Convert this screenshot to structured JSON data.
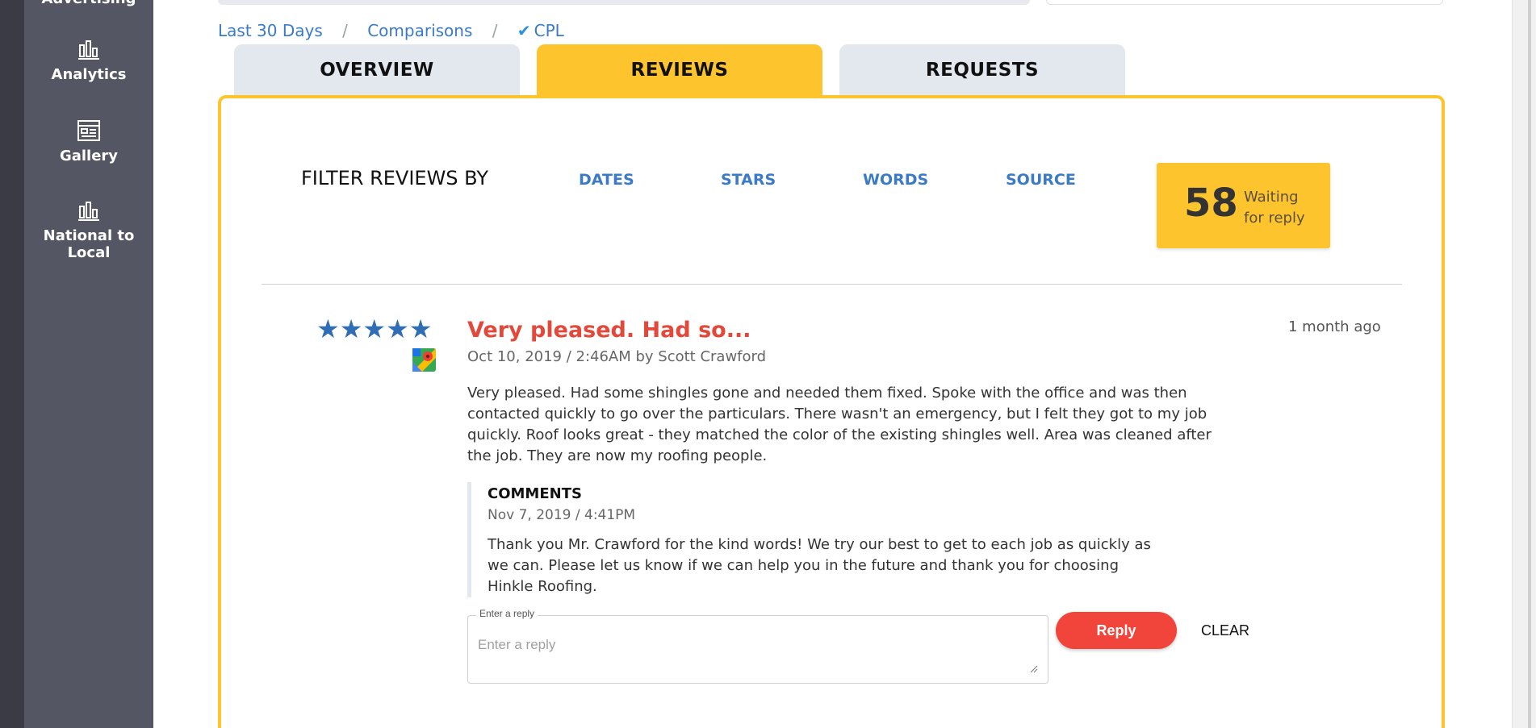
{
  "sidebar": {
    "items": [
      {
        "label": "Advertising"
      },
      {
        "label": "Analytics"
      },
      {
        "label": "Gallery"
      },
      {
        "label": "National to Local"
      }
    ]
  },
  "breadcrumb": {
    "items": [
      "Last 30 Days",
      "Comparisons",
      "CPL"
    ],
    "separator": "/"
  },
  "tabs": [
    {
      "label": "OVERVIEW",
      "active": false
    },
    {
      "label": "REVIEWS",
      "active": true
    },
    {
      "label": "REQUESTS",
      "active": false
    }
  ],
  "filter": {
    "title": "FILTER REVIEWS BY",
    "options": [
      "DATES",
      "STARS",
      "WORDS",
      "SOURCE"
    ]
  },
  "waiting": {
    "count": "58",
    "label_line1": "Waiting",
    "label_line2": "for reply"
  },
  "review": {
    "rating": 5,
    "stars": "★★★★★",
    "source_icon": "google-maps-icon",
    "title": "Very pleased. Had so...",
    "meta": "Oct 10, 2019 / 2:46AM by Scott Crawford",
    "age": "1 month ago",
    "body": "Very pleased. Had some shingles gone and needed them fixed. Spoke with the office and was then contacted quickly to go over the particulars. There wasn't an emergency, but I felt they got to my job quickly. Roof looks great - they matched the color of the existing shingles well. Area was cleaned after the job. They are now my roofing people.",
    "comments": {
      "title": "COMMENTS",
      "date": "Nov 7, 2019 / 4:41PM",
      "body": "Thank you Mr. Crawford for the kind words! We try our best to get to each job as quickly as we can. Please let us know if we can help you in the future and thank you for choosing Hinkle Roofing."
    }
  },
  "reply": {
    "label": "Enter a reply",
    "placeholder": "Enter a reply",
    "value": "",
    "button": "Reply",
    "clear": "CLEAR"
  },
  "colors": {
    "accent": "#fec42d",
    "sidebar": "#545663",
    "link": "#3b7ac6",
    "title_red": "#e2493b",
    "reply_button": "#f1453b"
  }
}
